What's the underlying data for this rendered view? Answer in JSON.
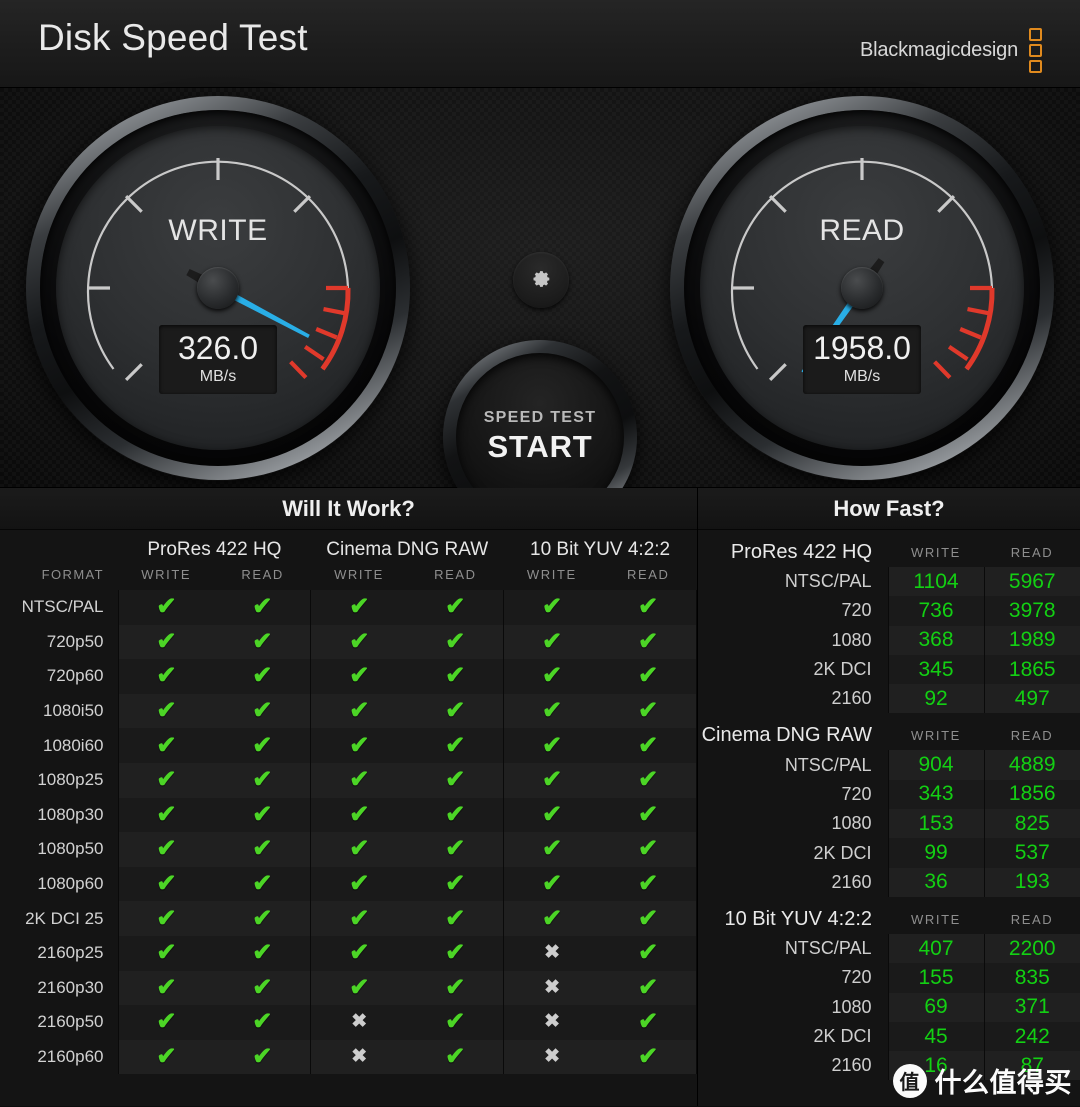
{
  "window": {
    "title": "Disk Speed Test",
    "brand": "Blackmagicdesign"
  },
  "gauges": {
    "write": {
      "label": "WRITE",
      "value": "326.0",
      "unit": "MB/s",
      "needle_angle_deg": 208
    },
    "read": {
      "label": "READ",
      "value": "1958.0",
      "unit": "MB/s",
      "needle_angle_deg": 305
    }
  },
  "controls": {
    "gear_icon": "gear-icon",
    "start_line1": "SPEED TEST",
    "start_line2": "START"
  },
  "will_it_work": {
    "title": "Will It Work?",
    "format_header": "FORMAT",
    "groups": [
      {
        "name": "ProRes 422 HQ",
        "columns": [
          "WRITE",
          "READ"
        ]
      },
      {
        "name": "Cinema DNG RAW",
        "columns": [
          "WRITE",
          "READ"
        ]
      },
      {
        "name": "10 Bit YUV 4:2:2",
        "columns": [
          "WRITE",
          "READ"
        ]
      }
    ],
    "rows": [
      {
        "format": "NTSC/PAL",
        "cells": [
          "ok",
          "ok",
          "ok",
          "ok",
          "ok",
          "ok"
        ]
      },
      {
        "format": "720p50",
        "cells": [
          "ok",
          "ok",
          "ok",
          "ok",
          "ok",
          "ok"
        ]
      },
      {
        "format": "720p60",
        "cells": [
          "ok",
          "ok",
          "ok",
          "ok",
          "ok",
          "ok"
        ]
      },
      {
        "format": "1080i50",
        "cells": [
          "ok",
          "ok",
          "ok",
          "ok",
          "ok",
          "ok"
        ]
      },
      {
        "format": "1080i60",
        "cells": [
          "ok",
          "ok",
          "ok",
          "ok",
          "ok",
          "ok"
        ]
      },
      {
        "format": "1080p25",
        "cells": [
          "ok",
          "ok",
          "ok",
          "ok",
          "ok",
          "ok"
        ]
      },
      {
        "format": "1080p30",
        "cells": [
          "ok",
          "ok",
          "ok",
          "ok",
          "ok",
          "ok"
        ]
      },
      {
        "format": "1080p50",
        "cells": [
          "ok",
          "ok",
          "ok",
          "ok",
          "ok",
          "ok"
        ]
      },
      {
        "format": "1080p60",
        "cells": [
          "ok",
          "ok",
          "ok",
          "ok",
          "ok",
          "ok"
        ]
      },
      {
        "format": "2K DCI 25",
        "cells": [
          "ok",
          "ok",
          "ok",
          "ok",
          "ok",
          "ok"
        ]
      },
      {
        "format": "2160p25",
        "cells": [
          "ok",
          "ok",
          "ok",
          "ok",
          "no",
          "ok"
        ]
      },
      {
        "format": "2160p30",
        "cells": [
          "ok",
          "ok",
          "ok",
          "ok",
          "no",
          "ok"
        ]
      },
      {
        "format": "2160p50",
        "cells": [
          "ok",
          "ok",
          "no",
          "ok",
          "no",
          "ok"
        ]
      },
      {
        "format": "2160p60",
        "cells": [
          "ok",
          "ok",
          "no",
          "ok",
          "no",
          "ok"
        ]
      }
    ],
    "marks": {
      "ok": "✔",
      "no": "✖"
    }
  },
  "how_fast": {
    "title": "How Fast?",
    "col_write": "WRITE",
    "col_read": "READ",
    "sections": [
      {
        "name": "ProRes 422 HQ",
        "rows": [
          {
            "label": "NTSC/PAL",
            "write": "1104",
            "read": "5967"
          },
          {
            "label": "720",
            "write": "736",
            "read": "3978"
          },
          {
            "label": "1080",
            "write": "368",
            "read": "1989"
          },
          {
            "label": "2K DCI",
            "write": "345",
            "read": "1865"
          },
          {
            "label": "2160",
            "write": "92",
            "read": "497"
          }
        ]
      },
      {
        "name": "Cinema DNG RAW",
        "rows": [
          {
            "label": "NTSC/PAL",
            "write": "904",
            "read": "4889"
          },
          {
            "label": "720",
            "write": "343",
            "read": "1856"
          },
          {
            "label": "1080",
            "write": "153",
            "read": "825"
          },
          {
            "label": "2K DCI",
            "write": "99",
            "read": "537"
          },
          {
            "label": "2160",
            "write": "36",
            "read": "193"
          }
        ]
      },
      {
        "name": "10 Bit YUV 4:2:2",
        "rows": [
          {
            "label": "NTSC/PAL",
            "write": "407",
            "read": "2200"
          },
          {
            "label": "720",
            "write": "155",
            "read": "835"
          },
          {
            "label": "1080",
            "write": "69",
            "read": "371"
          },
          {
            "label": "2K DCI",
            "write": "45",
            "read": "242"
          },
          {
            "label": "2160",
            "write": "16",
            "read": "87"
          }
        ]
      }
    ]
  },
  "watermark": {
    "badge": "值",
    "text": "什么值得买"
  },
  "colors": {
    "accent_orange": "#e08a1e",
    "needle_blue": "#29aee6",
    "ok_green": "#4cd526",
    "value_green": "#13d013",
    "redzone": "#e0392b"
  }
}
